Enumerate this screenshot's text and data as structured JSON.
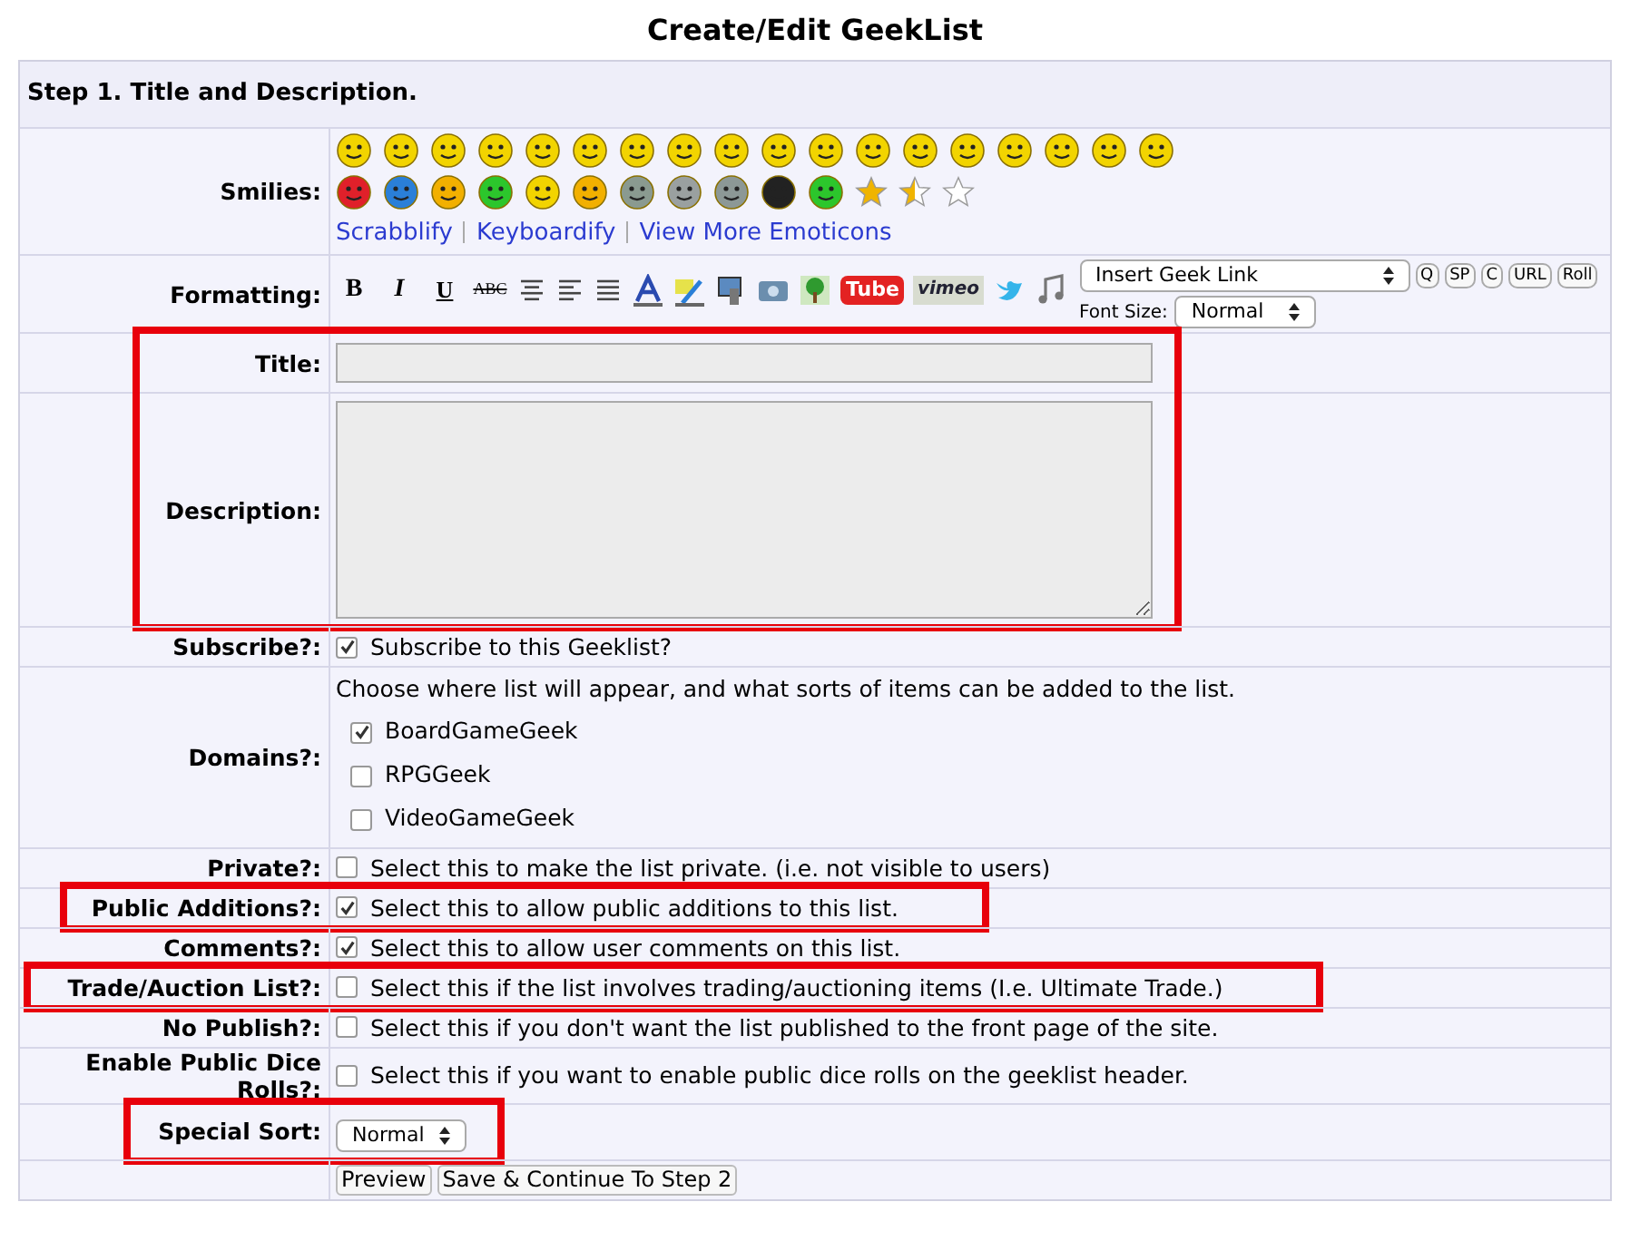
{
  "title": "Create/Edit GeekList",
  "step": "Step 1. Title and Description.",
  "rows": [
    {
      "kind": "smilies",
      "label": "Smilies:",
      "links": [
        "Scrabblify",
        "Keyboardify",
        "View More Emoticons"
      ],
      "highlighted": false
    },
    {
      "kind": "formatting",
      "label": "Formatting:",
      "text_buttons": [
        "B",
        "I",
        "U",
        "ABC"
      ],
      "video_buttons": [
        "Tube",
        "vimeo"
      ],
      "link_select": "Insert Geek Link",
      "tag_buttons": [
        "Q",
        "SP",
        "C",
        "URL",
        "Roll"
      ],
      "font_size_label": "Font Size:",
      "font_size": "Normal",
      "highlighted": false
    },
    {
      "kind": "text",
      "label": "Title:",
      "highlighted": true
    },
    {
      "kind": "textarea",
      "label": "Description:",
      "highlighted": true
    },
    {
      "kind": "checkbox",
      "label": "Subscribe?:",
      "text": "Subscribe to this Geeklist?",
      "checked": true,
      "highlighted": false
    },
    {
      "kind": "domains",
      "label": "Domains?:",
      "text": "Choose where list will appear, and what sorts of items can be added to the list.",
      "options": [
        {
          "label": "BoardGameGeek",
          "checked": true
        },
        {
          "label": "RPGGeek",
          "checked": false
        },
        {
          "label": "VideoGameGeek",
          "checked": false
        }
      ],
      "highlighted": false
    },
    {
      "kind": "checkbox",
      "label": "Private?:",
      "text": "Select this to make the list private. (i.e. not visible to users)",
      "checked": false,
      "highlighted": false
    },
    {
      "kind": "checkbox",
      "label": "Public Additions?:",
      "text": "Select this to allow public additions to this list.",
      "checked": true,
      "highlighted": true
    },
    {
      "kind": "checkbox",
      "label": "Comments?:",
      "text": "Select this to allow user comments on this list.",
      "checked": true,
      "highlighted": false
    },
    {
      "kind": "checkbox",
      "label": "Trade/Auction List?:",
      "text": "Select this if the list involves trading/auctioning items (I.e. Ultimate Trade.)",
      "checked": false,
      "highlighted": true
    },
    {
      "kind": "checkbox",
      "label": "No Publish?:",
      "text": "Select this if you don't want the list published to the front page of the site.",
      "checked": false,
      "highlighted": false
    },
    {
      "kind": "checkbox",
      "label": "Enable Public Dice Rolls?:",
      "text": "Select this if you want to enable public dice rolls on the geeklist header.",
      "checked": false,
      "highlighted": false
    },
    {
      "kind": "select",
      "label": "Special Sort:",
      "value": "Normal",
      "highlighted": true
    },
    {
      "kind": "buttons",
      "buttons": [
        "Preview",
        "Save & Continue To Step 2"
      ],
      "highlighted": false
    }
  ]
}
